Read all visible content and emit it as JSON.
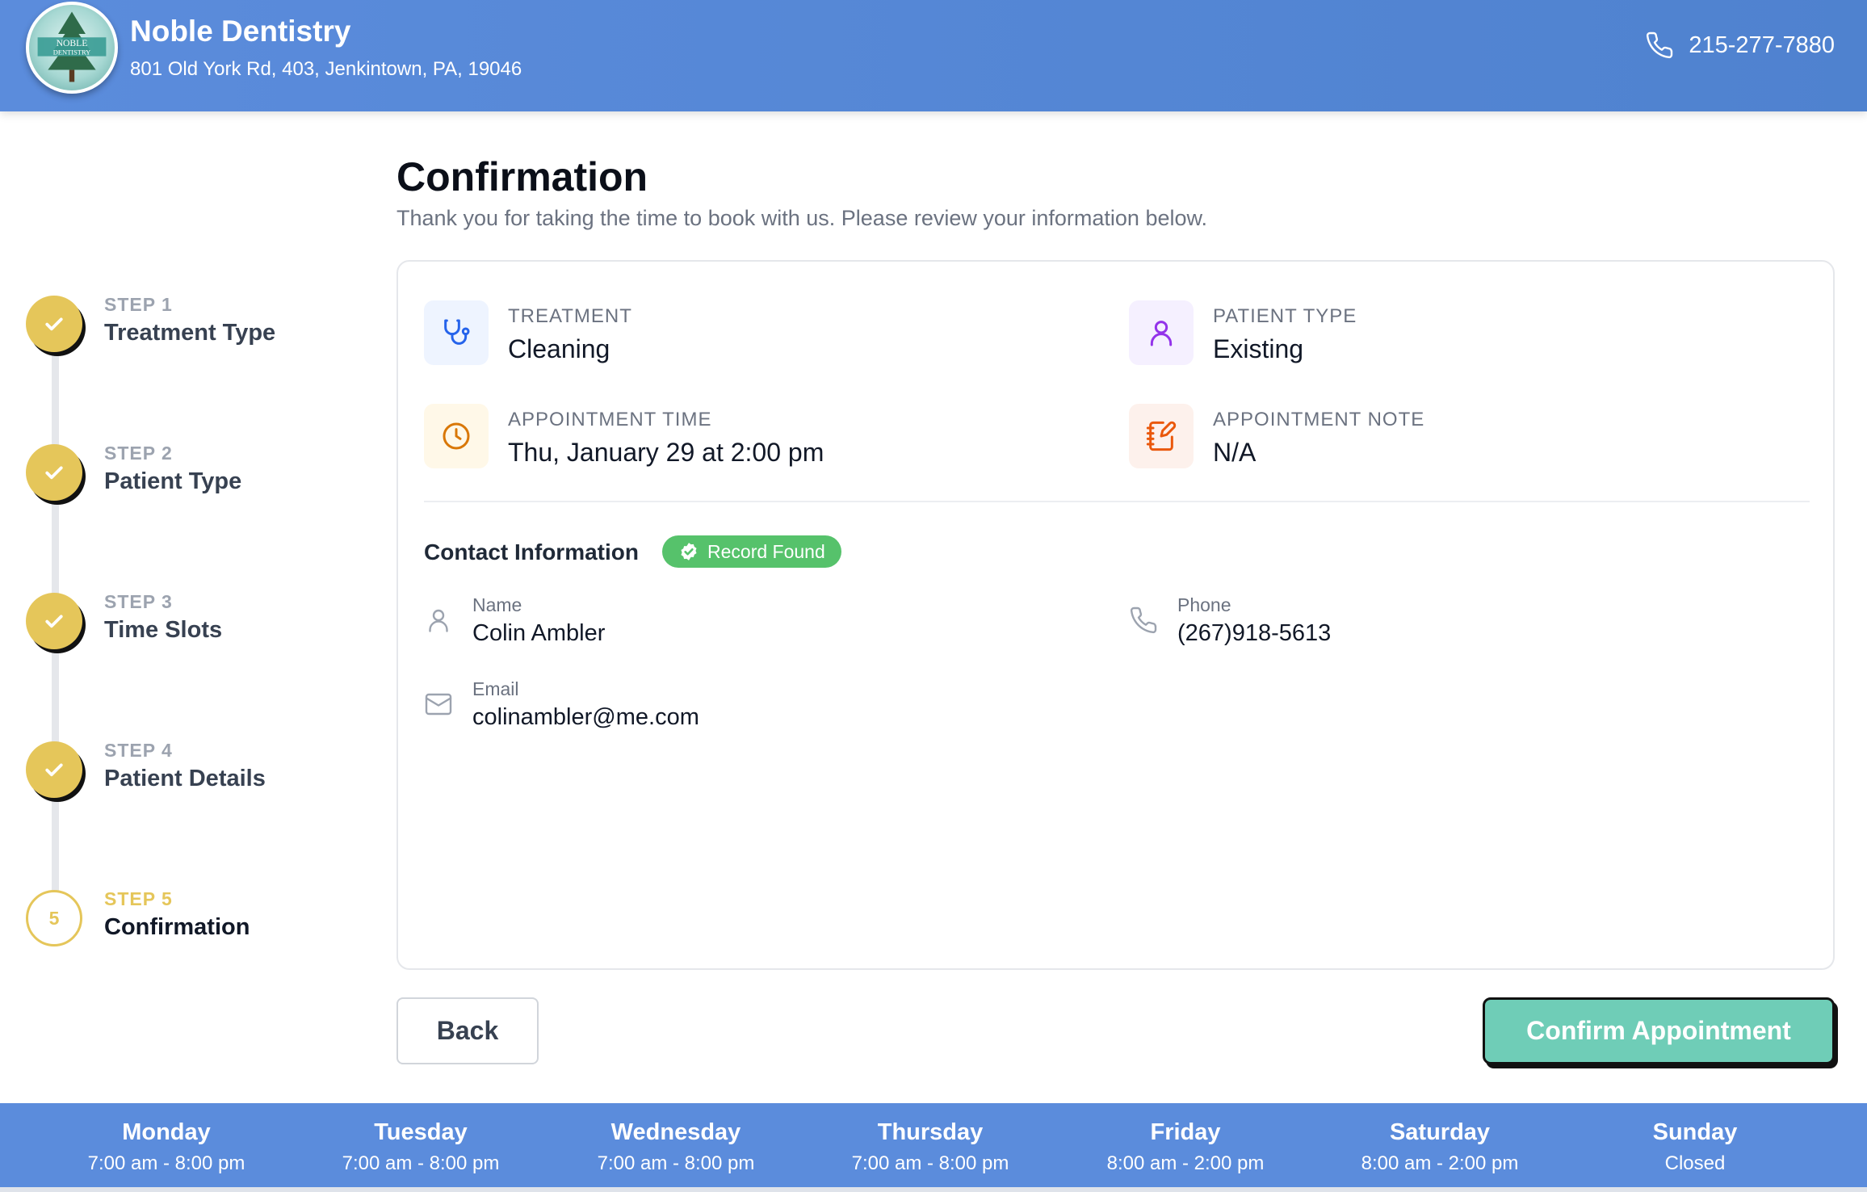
{
  "header": {
    "practice_name": "Noble Dentistry",
    "address": "801 Old York Rd, 403, Jenkintown, PA, 19046",
    "phone": "215-277-7880",
    "logo_text_1": "NOBLE",
    "logo_text_2": "DENTISTRY"
  },
  "steps": [
    {
      "number": "STEP 1",
      "title": "Treatment Type",
      "status": "complete"
    },
    {
      "number": "STEP 2",
      "title": "Patient Type",
      "status": "complete"
    },
    {
      "number": "STEP 3",
      "title": "Time Slots",
      "status": "complete"
    },
    {
      "number": "STEP 4",
      "title": "Patient Details",
      "status": "complete"
    },
    {
      "number": "STEP 5",
      "title": "Confirmation",
      "status": "current",
      "circle_label": "5"
    }
  ],
  "page": {
    "title": "Confirmation",
    "subtitle": "Thank you for taking the time to book with us. Please review your information below."
  },
  "summary": {
    "treatment": {
      "label": "TREATMENT",
      "value": "Cleaning"
    },
    "patient_type": {
      "label": "PATIENT TYPE",
      "value": "Existing"
    },
    "appointment_time": {
      "label": "APPOINTMENT TIME",
      "value": "Thu, January 29 at 2:00 pm"
    },
    "appointment_note": {
      "label": "APPOINTMENT NOTE",
      "value": "N/A"
    }
  },
  "contact": {
    "title": "Contact Information",
    "badge": "Record Found",
    "name_label": "Name",
    "name": "Colin Ambler",
    "phone_label": "Phone",
    "phone": "(267)918-5613",
    "email_label": "Email",
    "email": "colinambler@me.com"
  },
  "buttons": {
    "back": "Back",
    "confirm": "Confirm Appointment"
  },
  "hours": [
    {
      "day": "Monday",
      "hours": "7:00 am - 8:00 pm"
    },
    {
      "day": "Tuesday",
      "hours": "7:00 am - 8:00 pm"
    },
    {
      "day": "Wednesday",
      "hours": "7:00 am - 8:00 pm"
    },
    {
      "day": "Thursday",
      "hours": "7:00 am - 8:00 pm"
    },
    {
      "day": "Friday",
      "hours": "8:00 am - 2:00 pm"
    },
    {
      "day": "Saturday",
      "hours": "8:00 am - 2:00 pm"
    },
    {
      "day": "Sunday",
      "hours": "Closed"
    }
  ],
  "colors": {
    "header_blue": "#5b8cdc",
    "step_gold": "#e5c65a",
    "badge_green": "#56c26b",
    "confirm_teal": "#6fcdb7"
  }
}
